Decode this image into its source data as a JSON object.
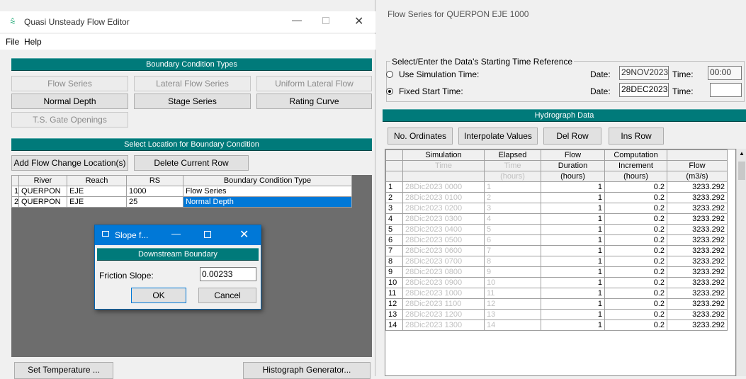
{
  "editor": {
    "title": "Quasi Unsteady Flow Editor",
    "menu": [
      "File",
      "Help"
    ],
    "bct_header": "Boundary Condition Types",
    "bct_buttons": [
      {
        "label": "Flow Series",
        "enabled": false
      },
      {
        "label": "Lateral Flow Series",
        "enabled": false
      },
      {
        "label": "Uniform Lateral Flow",
        "enabled": false
      },
      {
        "label": "Normal Depth",
        "enabled": true
      },
      {
        "label": "Stage Series",
        "enabled": true
      },
      {
        "label": "Rating Curve",
        "enabled": true
      },
      {
        "label": "T.S. Gate Openings",
        "enabled": false
      }
    ],
    "location_header": "Select Location for Boundary Condition",
    "add_location_label": "Add Flow Change Location(s)",
    "delete_row_label": "Delete Current Row",
    "columns": [
      "River",
      "Reach",
      "RS",
      "Boundary Condition Type"
    ],
    "rows": [
      {
        "n": "1",
        "river": "QUERPON",
        "reach": "EJE",
        "rs": "1000",
        "type": "Flow Series",
        "selected": false
      },
      {
        "n": "2",
        "river": "QUERPON",
        "reach": "EJE",
        "rs": "25",
        "type": "Normal Depth",
        "selected": true
      }
    ],
    "set_temperature_label": "Set Temperature ...",
    "histograph_label": "Histograph Generator..."
  },
  "slope_dialog": {
    "title": "Slope f...",
    "header": "Downstream Boundary",
    "field_label": "Friction Slope:",
    "field_value": "0.00233",
    "ok_label": "OK",
    "cancel_label": "Cancel"
  },
  "flow_series": {
    "title": "Flow Series for QUERPON EJE 1000",
    "time_ref_label": "Select/Enter the Data's Starting Time Reference",
    "use_sim_label": "Use Simulation Time:",
    "fixed_start_label": "Fixed Start Time:",
    "date_label": "Date:",
    "time_label": "Time:",
    "sim_date": "29NOV2023",
    "sim_time": "00:00",
    "fixed_date": "28DEC2023",
    "fixed_time": "",
    "selected_option": "fixed",
    "hydrograph_header": "Hydrograph Data",
    "buttons": [
      "No. Ordinates",
      "Interpolate Values",
      "Del Row",
      "Ins Row"
    ],
    "header_row1": [
      "Simulation",
      "Elapsed",
      "Flow",
      "Computation",
      ""
    ],
    "header_row2": [
      "Time",
      "Time",
      "Duration",
      "Increment",
      "Flow"
    ],
    "header_row3": [
      "",
      "(hours)",
      "(hours)",
      "(hours)",
      "(m3/s)"
    ],
    "rows": [
      {
        "n": "1",
        "sim": "28Dic2023 0000",
        "elapsed": "1",
        "dur": "1",
        "inc": "0.2",
        "flow": "3233.292"
      },
      {
        "n": "2",
        "sim": "28Dic2023 0100",
        "elapsed": "2",
        "dur": "1",
        "inc": "0.2",
        "flow": "3233.292"
      },
      {
        "n": "3",
        "sim": "28Dic2023 0200",
        "elapsed": "3",
        "dur": "1",
        "inc": "0.2",
        "flow": "3233.292"
      },
      {
        "n": "4",
        "sim": "28Dic2023 0300",
        "elapsed": "4",
        "dur": "1",
        "inc": "0.2",
        "flow": "3233.292"
      },
      {
        "n": "5",
        "sim": "28Dic2023 0400",
        "elapsed": "5",
        "dur": "1",
        "inc": "0.2",
        "flow": "3233.292"
      },
      {
        "n": "6",
        "sim": "28Dic2023 0500",
        "elapsed": "6",
        "dur": "1",
        "inc": "0.2",
        "flow": "3233.292"
      },
      {
        "n": "7",
        "sim": "28Dic2023 0600",
        "elapsed": "7",
        "dur": "1",
        "inc": "0.2",
        "flow": "3233.292"
      },
      {
        "n": "8",
        "sim": "28Dic2023 0700",
        "elapsed": "8",
        "dur": "1",
        "inc": "0.2",
        "flow": "3233.292"
      },
      {
        "n": "9",
        "sim": "28Dic2023 0800",
        "elapsed": "9",
        "dur": "1",
        "inc": "0.2",
        "flow": "3233.292"
      },
      {
        "n": "10",
        "sim": "28Dic2023 0900",
        "elapsed": "10",
        "dur": "1",
        "inc": "0.2",
        "flow": "3233.292"
      },
      {
        "n": "11",
        "sim": "28Dic2023 1000",
        "elapsed": "11",
        "dur": "1",
        "inc": "0.2",
        "flow": "3233.292"
      },
      {
        "n": "12",
        "sim": "28Dic2023 1100",
        "elapsed": "12",
        "dur": "1",
        "inc": "0.2",
        "flow": "3233.292"
      },
      {
        "n": "13",
        "sim": "28Dic2023 1200",
        "elapsed": "13",
        "dur": "1",
        "inc": "0.2",
        "flow": "3233.292"
      },
      {
        "n": "14",
        "sim": "28Dic2023 1300",
        "elapsed": "14",
        "dur": "1",
        "inc": "0.2",
        "flow": "3233.292"
      }
    ]
  },
  "colors": {
    "teal": "#007a7a",
    "selection": "#0078d7",
    "dark_area": "#6d6d6d"
  }
}
